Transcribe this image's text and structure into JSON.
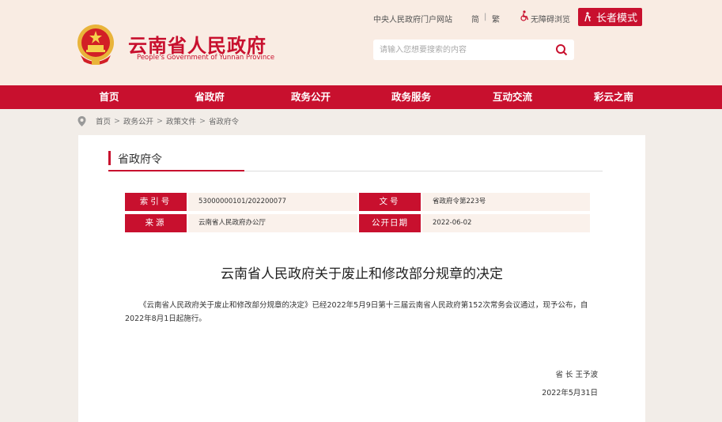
{
  "header": {
    "title": "云南省人民政府",
    "subtitle": "People's Government of Yunnan Province",
    "links": {
      "central_portal": "中央人民政府门户网站",
      "simplified": "简",
      "divider": "|",
      "traditional": "繁",
      "accessible": "无障碍浏览"
    },
    "elder_mode": "长者模式",
    "search_placeholder": "请输入您想要搜索的内容"
  },
  "nav": [
    "首页",
    "省政府",
    "政务公开",
    "政务服务",
    "互动交流",
    "彩云之南"
  ],
  "breadcrumb": [
    "首页",
    "政务公开",
    "政策文件",
    "省政府令"
  ],
  "breadcrumb_sep": ">",
  "section": {
    "title": "省政府令"
  },
  "meta": {
    "index_label": "索引号",
    "index_value": "53000000101/202200077",
    "doc_no_label": "文号",
    "doc_no_value": "省政府令第223号",
    "source_label": "来源",
    "source_value": "云南省人民政府办公厅",
    "date_label": "公开日期",
    "date_value": "2022-06-02"
  },
  "document": {
    "title": "云南省人民政府关于废止和修改部分规章的决定",
    "body": "《云南省人民政府关于废止和修改部分规章的决定》已经2022年5月9日第十三届云南省人民政府第152次常务会议通过，现予公布，自2022年8月1日起施行。",
    "signer": "省 长  王予波",
    "sign_date": "2022年5月31日"
  },
  "colors": {
    "brand_red": "#c8102e",
    "header_bg": "#f9ece3",
    "page_bg": "#f2ede8",
    "meta_bg": "#faf1eb"
  }
}
